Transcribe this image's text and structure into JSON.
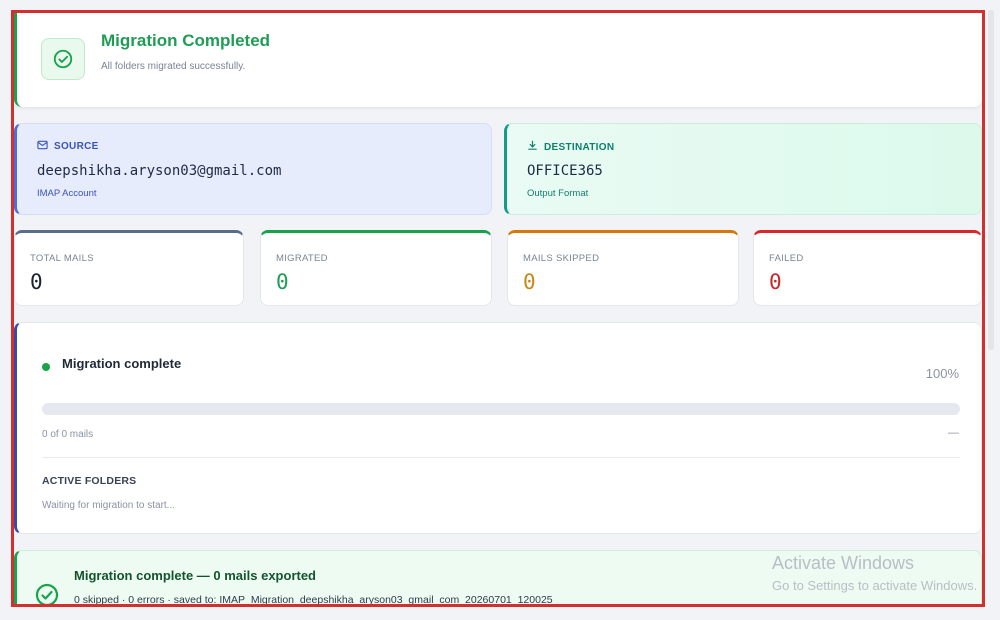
{
  "header": {
    "title": "Migration Completed",
    "subtitle": "All folders migrated successfully.",
    "icon": "check-circle-icon"
  },
  "source": {
    "label": "SOURCE",
    "value": "deepshikha.aryson03@gmail.com",
    "sublabel": "IMAP Account",
    "icon": "mail-icon"
  },
  "destination": {
    "label": "DESTINATION",
    "value": "OFFICE365",
    "sublabel": "Output Format",
    "icon": "download-icon"
  },
  "stats": [
    {
      "label": "TOTAL MAILS",
      "value": "0",
      "color": "#5b6b8a"
    },
    {
      "label": "MIGRATED",
      "value": "0",
      "color": "#16a34a"
    },
    {
      "label": "MAILS SKIPPED",
      "value": "0",
      "color": "#d97706"
    },
    {
      "label": "FAILED",
      "value": "0",
      "color": "#dc2626"
    }
  ],
  "progress": {
    "status": "Migration complete",
    "percent_label": "100%",
    "count_text": "0 of 0 mails",
    "eta": "—",
    "active_folders_title": "ACTIVE FOLDERS",
    "active_folders_text": "Waiting for migration to start..."
  },
  "completion": {
    "title": "Migration complete — 0 mails exported",
    "details": "0 skipped · 0 errors · saved to: IMAP_Migration_deepshikha_aryson03_gmail_com_20260701_120025"
  },
  "watermark": {
    "title": "Activate Windows",
    "subtitle": "Go to Settings to activate Windows."
  },
  "colors": {
    "success": "#16a34a",
    "accent": "#3949ab",
    "highlight_border": "#d32f2f"
  }
}
